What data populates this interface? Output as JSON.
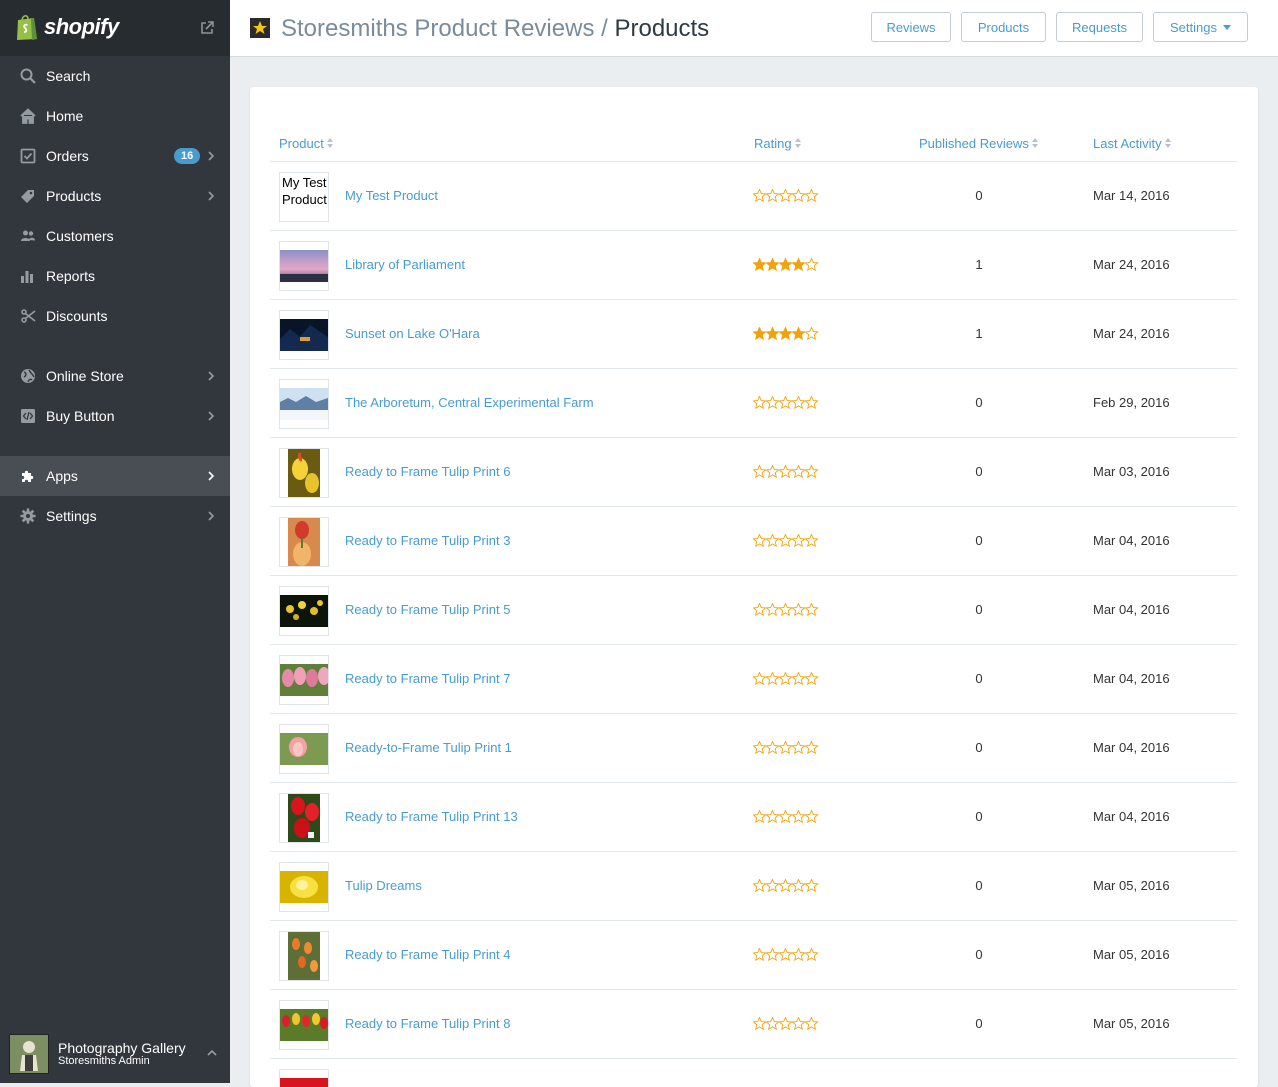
{
  "sidebar": {
    "brand": "shopify",
    "items": [
      {
        "label": "Search",
        "icon": "search-icon"
      },
      {
        "label": "Home",
        "icon": "home-icon"
      },
      {
        "label": "Orders",
        "icon": "orders-icon",
        "badge": "16"
      },
      {
        "label": "Products",
        "icon": "tag-icon"
      },
      {
        "label": "Customers",
        "icon": "customers-icon"
      },
      {
        "label": "Reports",
        "icon": "reports-icon"
      },
      {
        "label": "Discounts",
        "icon": "discounts-icon"
      },
      {
        "label": "Online Store",
        "icon": "globe-icon"
      },
      {
        "label": "Buy Button",
        "icon": "code-icon"
      },
      {
        "label": "Apps",
        "icon": "puzzle-icon"
      },
      {
        "label": "Settings",
        "icon": "gear-icon"
      }
    ],
    "account": {
      "name": "Photography Gallery",
      "role": "Storesmiths Admin"
    }
  },
  "header": {
    "app_name": "Storesmiths Product Reviews",
    "separator": "/",
    "page": "Products",
    "buttons": {
      "reviews": "Reviews",
      "products": "Products",
      "requests": "Requests",
      "settings": "Settings"
    }
  },
  "table": {
    "columns": {
      "product": "Product",
      "rating": "Rating",
      "published": "Published Reviews",
      "last_activity": "Last Activity"
    },
    "rows": [
      {
        "name": "My Test Product",
        "thumb_text": "My Test Product",
        "thumb_l1": "My Test",
        "thumb_l2": "Product",
        "rating": 0,
        "published": "0",
        "last": "Mar 14, 2016"
      },
      {
        "name": "Library of Parliament",
        "thumb": "dusk",
        "rating": 4,
        "published": "1",
        "last": "Mar 24, 2016"
      },
      {
        "name": "Sunset on Lake O'Hara",
        "thumb": "night",
        "rating": 4,
        "published": "1",
        "last": "Mar 24, 2016"
      },
      {
        "name": "The Arboretum, Central Experimental Farm",
        "thumb": "winter",
        "rating": 0,
        "published": "0",
        "last": "Feb 29, 2016"
      },
      {
        "name": "Ready to Frame Tulip Print 6",
        "thumb": "tulip-yellow",
        "rating": 0,
        "published": "0",
        "last": "Mar 03, 2016"
      },
      {
        "name": "Ready to Frame Tulip Print 3",
        "thumb": "tulip-orange",
        "rating": 0,
        "published": "0",
        "last": "Mar 04, 2016"
      },
      {
        "name": "Ready to Frame Tulip Print 5",
        "thumb": "tulip-dark",
        "rating": 0,
        "published": "0",
        "last": "Mar 04, 2016"
      },
      {
        "name": "Ready to Frame Tulip Print 7",
        "thumb": "tulip-pink",
        "rating": 0,
        "published": "0",
        "last": "Mar 04, 2016"
      },
      {
        "name": "Ready-to-Frame Tulip Print 1",
        "thumb": "tulip-soft",
        "rating": 0,
        "published": "0",
        "last": "Mar 04, 2016"
      },
      {
        "name": "Ready to Frame Tulip Print 13",
        "thumb": "tulip-red",
        "rating": 0,
        "published": "0",
        "last": "Mar 04, 2016"
      },
      {
        "name": "Tulip Dreams",
        "thumb": "tulip-dream",
        "rating": 0,
        "published": "0",
        "last": "Mar 05, 2016"
      },
      {
        "name": "Ready to Frame Tulip Print 4",
        "thumb": "tulip-field",
        "rating": 0,
        "published": "0",
        "last": "Mar 05, 2016"
      },
      {
        "name": "Ready to Frame Tulip Print 8",
        "thumb": "tulip-mixed",
        "rating": 0,
        "published": "0",
        "last": "Mar 05, 2016"
      }
    ]
  },
  "colors": {
    "accent": "#479ccf",
    "star": "#f0a30a",
    "sidebar": "#31373d"
  }
}
